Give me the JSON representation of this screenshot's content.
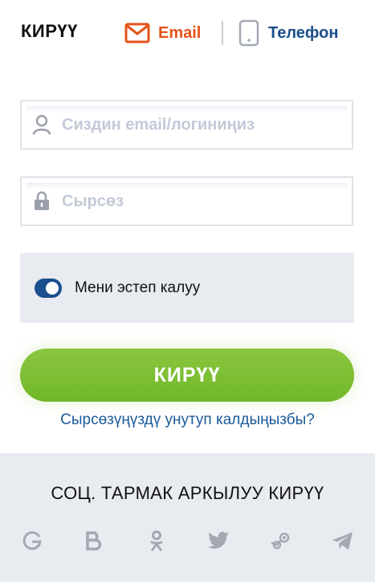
{
  "header": {
    "title": "КИРҮҮ",
    "tabs": [
      {
        "label": "Email",
        "icon": "envelope-icon",
        "color": "#e5531b"
      },
      {
        "label": "Телефон",
        "icon": "phone-icon",
        "color": "#1b4f8a"
      }
    ]
  },
  "form": {
    "login_placeholder": "Сиздин email/логиниңиз",
    "login_value": "",
    "password_placeholder": "Сырсөз",
    "password_value": "",
    "remember_label": "Мени эстеп калуу",
    "remember_checked": true,
    "submit_label": "КИРҮҮ",
    "forgot_label": "Сырсөзүңүздү унутуп калдыңызбы?"
  },
  "social": {
    "title": "СОЦ. ТАРМАК АРКЫЛУУ КИРҮҮ",
    "providers": [
      "google-icon",
      "vk-icon",
      "odnoklassniki-icon",
      "twitter-icon",
      "steam-icon",
      "telegram-icon"
    ]
  },
  "colors": {
    "accent_orange": "#e5531b",
    "accent_blue": "#1b4f8a",
    "button_green": "#7dbf33",
    "panel_gray": "#e8ebf0"
  }
}
